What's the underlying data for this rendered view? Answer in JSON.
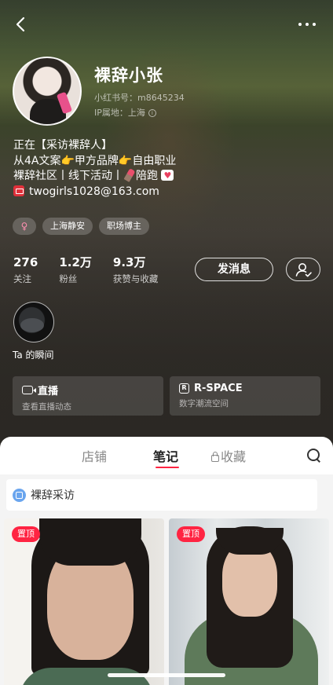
{
  "profile": {
    "name": "裸辞小张",
    "red_id": "小红书号：m8645234",
    "ip": "IP属地：上海",
    "bio": {
      "line1": "正在【采访裸辞人】",
      "line2_a": "从4A文案",
      "line2_b": "甲方品牌",
      "line2_c": "自由职业",
      "line3_a": "裸辞社区丨线下活动丨",
      "line3_b": "陪跑",
      "email": "twogirls1028@163.com"
    },
    "tags": [
      "♀",
      "上海静安",
      "职场博主"
    ]
  },
  "stats": [
    {
      "value": "276",
      "label": "关注"
    },
    {
      "value": "1.2万",
      "label": "粉丝"
    },
    {
      "value": "9.3万",
      "label": "获赞与收藏"
    }
  ],
  "actions": {
    "message": "发消息"
  },
  "moments": {
    "label": "Ta 的瞬间"
  },
  "cards": [
    {
      "title": "直播",
      "subtitle": "查看直播动态"
    },
    {
      "title": "R-SPACE",
      "subtitle": "数字潮流空间"
    }
  ],
  "tabs": [
    "店铺",
    "笔记",
    "收藏"
  ],
  "active_tab": "笔记",
  "album": {
    "label": "裸辞采访"
  },
  "notes": [
    {
      "badge": "置顶"
    },
    {
      "badge": "置顶"
    }
  ],
  "colors": {
    "accent": "#ff2442",
    "album_icon": "#6aa5ee"
  }
}
